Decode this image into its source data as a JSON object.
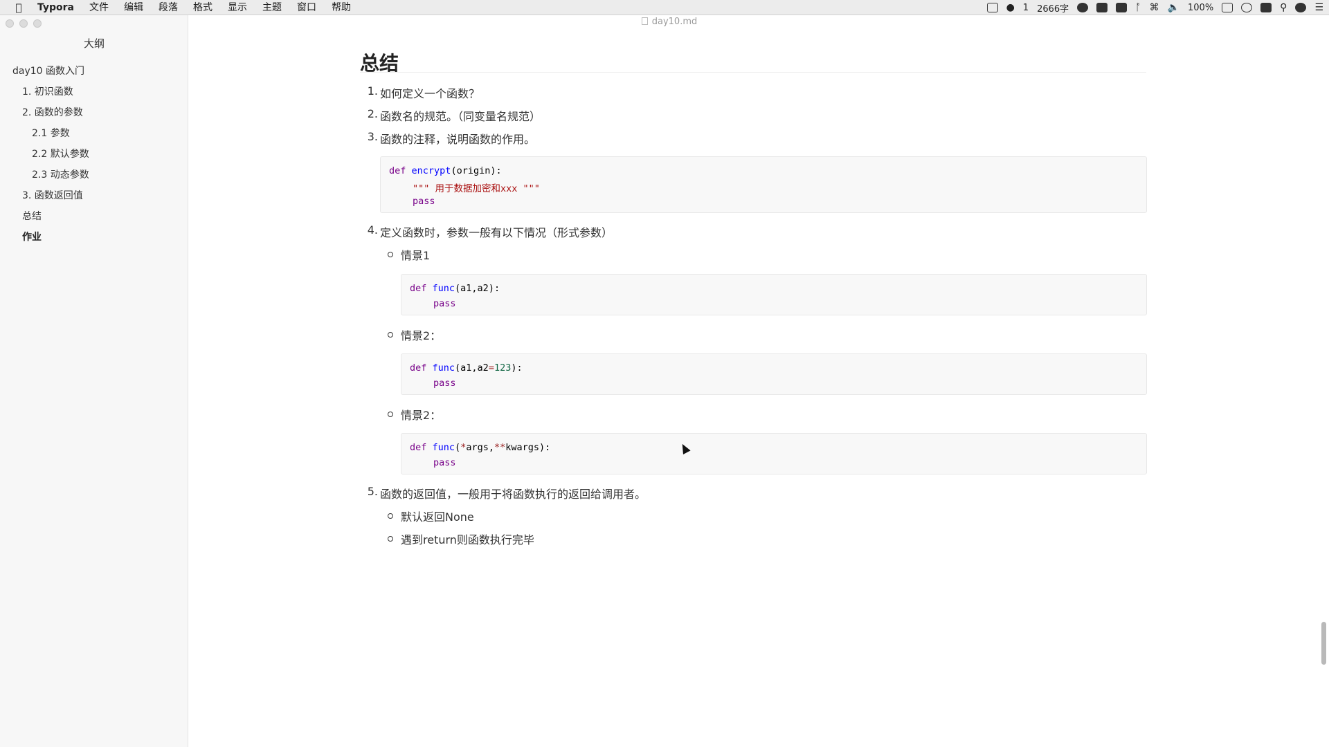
{
  "menubar": {
    "app_name": "Typora",
    "items": [
      "文件",
      "编辑",
      "段落",
      "格式",
      "显示",
      "主题",
      "窗口",
      "帮助"
    ],
    "wechat_count": "1",
    "word_count": "2666字",
    "battery": "100%"
  },
  "window": {
    "file_name": "day10.md"
  },
  "sidebar": {
    "title": "大纲",
    "items": [
      {
        "label": "day10 函数入门",
        "level": 0
      },
      {
        "label": "1. 初识函数",
        "level": 1
      },
      {
        "label": "2. 函数的参数",
        "level": 1
      },
      {
        "label": "2.1 参数",
        "level": 2
      },
      {
        "label": "2.2 默认参数",
        "level": 2
      },
      {
        "label": "2.3 动态参数",
        "level": 2
      },
      {
        "label": "3. 函数返回值",
        "level": 1
      },
      {
        "label": "总结",
        "level": 1
      },
      {
        "label": "作业",
        "level": 1,
        "active": true
      }
    ]
  },
  "document": {
    "heading": "总结",
    "list": [
      {
        "num": "1.",
        "text": "如何定义一个函数？"
      },
      {
        "num": "2.",
        "text": "函数名的规范。（同变量名规范）"
      },
      {
        "num": "3.",
        "text": "函数的注释，说明函数的作用。"
      },
      {
        "num": "4.",
        "text": "定义函数时，参数一般有以下情况（形式参数）"
      },
      {
        "num": "5.",
        "text": "函数的返回值，一般用于将函数执行的返回给调用者。"
      }
    ],
    "code1": {
      "l1_kw": "def",
      "l1_fn": "encrypt",
      "l1_rest": "(origin):",
      "l2_str": "\"\"\" 用于数据加密和xxx \"\"\"",
      "l3_kw": "pass"
    },
    "sub_items": {
      "s1": "情景1",
      "s2": "情景2：",
      "s3": "情景2："
    },
    "code2": {
      "kw": "def",
      "fn": "func",
      "rest": "(a1,a2):",
      "pass": "pass"
    },
    "code3": {
      "kw": "def",
      "fn": "func",
      "rest_a": "(a1,a2",
      "op": "=",
      "num": "123",
      "rest_b": "):",
      "pass": "pass"
    },
    "code4": {
      "kw": "def",
      "fn": "func",
      "open": "(",
      "op1": "*",
      "args": "args,",
      "op2": "**",
      "kwargs": "kwargs",
      "close": "):",
      "pass": "pass"
    },
    "return_items": {
      "r1": "默认返回None",
      "r2": "遇到return则函数执行完毕"
    }
  }
}
